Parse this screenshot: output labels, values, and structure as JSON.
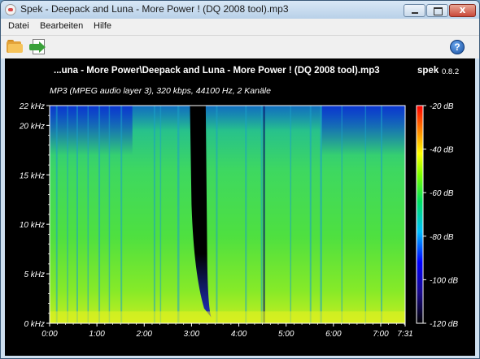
{
  "window": {
    "title": "Spek - Deepack and Luna - More Power ! (DQ 2008 tool).mp3",
    "close_glyph": "x"
  },
  "menu": {
    "items": [
      "Datei",
      "Bearbeiten",
      "Hilfe"
    ]
  },
  "toolbar": {
    "open_icon": "folder-open-icon",
    "save_icon": "save-export-icon",
    "help_icon": "help-icon",
    "help_glyph": "?"
  },
  "spectrogram": {
    "file_title": "...una - More Power\\Deepack and Luna - More Power ! (DQ 2008 tool).mp3",
    "app_name": "spek",
    "app_version": "0.8.2",
    "audio_info": "MP3 (MPEG audio layer 3), 320 kbps, 44100 Hz, 2 Kanäle"
  },
  "chart_data": {
    "type": "heatmap",
    "title": "...una - More Power\\Deepack and Luna - More Power ! (DQ 2008 tool).mp3",
    "subtitle": "MP3 (MPEG audio layer 3), 320 kbps, 44100 Hz, 2 Kanäle",
    "x_ticks": [
      "0:00",
      "1:00",
      "2:00",
      "3:00",
      "4:00",
      "5:00",
      "6:00",
      "7:00",
      "7:31"
    ],
    "x_tick_seconds": [
      0,
      60,
      120,
      180,
      240,
      300,
      360,
      420,
      451
    ],
    "xlim": [
      0,
      451
    ],
    "y_ticks": [
      "0 kHz",
      "5 kHz",
      "10 kHz",
      "15 kHz",
      "20 kHz",
      "22 kHz"
    ],
    "y_tick_khz": [
      0,
      5,
      10,
      15,
      20,
      22
    ],
    "ylim": [
      0,
      22
    ],
    "colorbar_ticks": [
      "-20 dB",
      "-40 dB",
      "-60 dB",
      "-80 dB",
      "-100 dB",
      "-120 dB"
    ],
    "colorbar_db": [
      -20,
      -40,
      -60,
      -80,
      -100,
      -120
    ],
    "colorbar_range": [
      -120,
      -20
    ],
    "colormap": [
      "#000000",
      "#1a0a8a",
      "#0000ff",
      "#00bfff",
      "#00e060",
      "#7aff00",
      "#ffff00",
      "#ff8000",
      "#ff0000"
    ]
  }
}
